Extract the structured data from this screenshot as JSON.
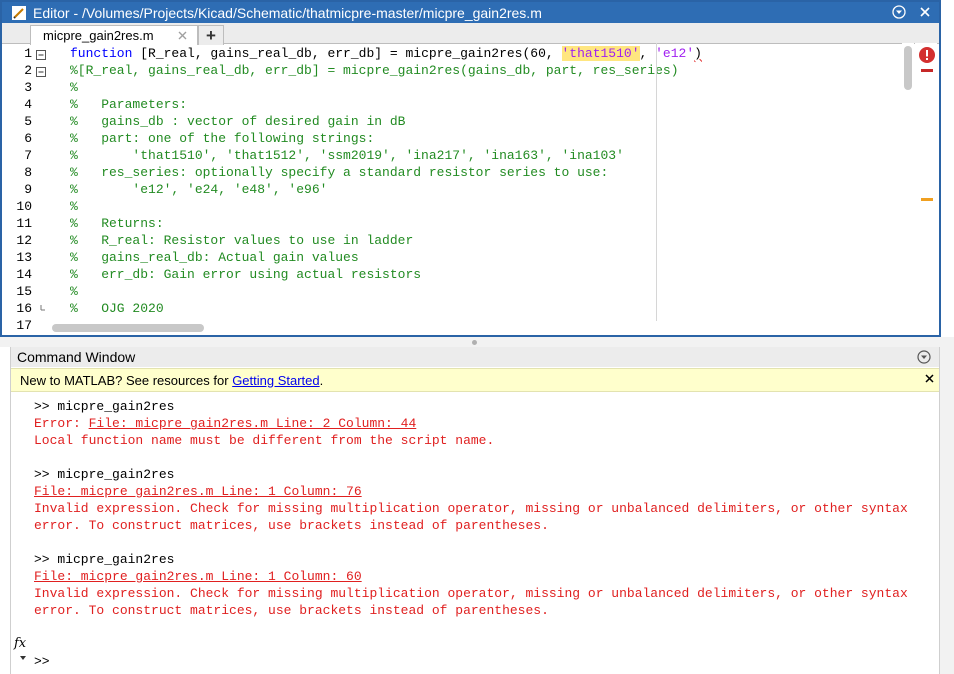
{
  "editor": {
    "title": "Editor - /Volumes/Projects/Kicad/Schematic/thatmicpre-master/micpre_gain2res.m",
    "tab_label": "micpre_gain2res.m",
    "add_tab": "+",
    "lines": [
      {
        "n": "1",
        "fold": "minus",
        "parts": [
          {
            "t": "function",
            "c": "kw"
          },
          {
            "t": " [R_real, gains_real_db, err_db] = micpre_gain2res(60, ",
            "c": ""
          },
          {
            "t": "'that1510'",
            "c": "str-hl"
          },
          {
            "t": ", ",
            "c": ""
          },
          {
            "t": "'e12'",
            "c": "str"
          },
          {
            "t": ")",
            "c": "squig"
          }
        ]
      },
      {
        "n": "2",
        "fold": "minus",
        "parts": [
          {
            "t": "%[R_real, gains_real_db, err_db] = micpre_gain2res(gains_db, part, res_series)",
            "c": "com"
          }
        ]
      },
      {
        "n": "3",
        "fold": "",
        "parts": [
          {
            "t": "%",
            "c": "com"
          }
        ]
      },
      {
        "n": "4",
        "fold": "",
        "parts": [
          {
            "t": "%   Parameters:",
            "c": "com"
          }
        ]
      },
      {
        "n": "5",
        "fold": "",
        "parts": [
          {
            "t": "%   gains_db : vector of desired gain in dB",
            "c": "com"
          }
        ]
      },
      {
        "n": "6",
        "fold": "",
        "parts": [
          {
            "t": "%   part: one of the following strings:",
            "c": "com"
          }
        ]
      },
      {
        "n": "7",
        "fold": "",
        "parts": [
          {
            "t": "%       'that1510', 'that1512', 'ssm2019', 'ina217', 'ina163', 'ina103'",
            "c": "com"
          }
        ]
      },
      {
        "n": "8",
        "fold": "",
        "parts": [
          {
            "t": "%   res_series: optionally specify a standard resistor series to use:",
            "c": "com"
          }
        ]
      },
      {
        "n": "9",
        "fold": "",
        "parts": [
          {
            "t": "%       'e12', 'e24, 'e48', 'e96'",
            "c": "com"
          }
        ]
      },
      {
        "n": "10",
        "fold": "",
        "parts": [
          {
            "t": "%",
            "c": "com"
          }
        ]
      },
      {
        "n": "11",
        "fold": "",
        "parts": [
          {
            "t": "%   Returns:",
            "c": "com"
          }
        ]
      },
      {
        "n": "12",
        "fold": "",
        "parts": [
          {
            "t": "%   R_real: Resistor values to use in ladder",
            "c": "com"
          }
        ]
      },
      {
        "n": "13",
        "fold": "",
        "parts": [
          {
            "t": "%   gains_real_db: Actual gain values",
            "c": "com"
          }
        ]
      },
      {
        "n": "14",
        "fold": "",
        "parts": [
          {
            "t": "%   err_db: Gain error using actual resistors",
            "c": "com"
          }
        ]
      },
      {
        "n": "15",
        "fold": "",
        "parts": [
          {
            "t": "%",
            "c": "com"
          }
        ]
      },
      {
        "n": "16",
        "fold": "end",
        "parts": [
          {
            "t": "%   OJG 2020",
            "c": "com"
          }
        ]
      },
      {
        "n": "17",
        "fold": "",
        "parts": [
          {
            "t": "",
            "c": ""
          }
        ]
      }
    ]
  },
  "command_window": {
    "title": "Command Window",
    "info": {
      "text": "New to MATLAB? See resources for ",
      "link": "Getting Started",
      "suffix": "."
    },
    "entries": [
      {
        "kind": "prompt",
        "text": ">> micpre_gain2res"
      },
      {
        "kind": "err-mixed",
        "prefix": "Error: ",
        "link": "File: micpre_gain2res.m Line: 2 Column: 44"
      },
      {
        "kind": "err",
        "text": "Local function name must be different from the script name."
      },
      {
        "kind": "blank",
        "text": ""
      },
      {
        "kind": "prompt",
        "text": ">> micpre_gain2res"
      },
      {
        "kind": "err-link",
        "text": "File: micpre_gain2res.m Line: 1 Column: 76"
      },
      {
        "kind": "err",
        "text": "Invalid expression. Check for missing multiplication operator, missing or unbalanced delimiters, or other syntax"
      },
      {
        "kind": "err",
        "text": "error. To construct matrices, use brackets instead of parentheses."
      },
      {
        "kind": "blank",
        "text": ""
      },
      {
        "kind": "prompt",
        "text": ">> micpre_gain2res"
      },
      {
        "kind": "err-link",
        "text": "File: micpre_gain2res.m Line: 1 Column: 60"
      },
      {
        "kind": "err",
        "text": "Invalid expression. Check for missing multiplication operator, missing or unbalanced delimiters, or other syntax"
      },
      {
        "kind": "err",
        "text": "error. To construct matrices, use brackets instead of parentheses."
      },
      {
        "kind": "blank",
        "text": ""
      },
      {
        "kind": "blank",
        "text": ""
      },
      {
        "kind": "prompt",
        "text": ">>"
      }
    ],
    "fx_label": "fx"
  },
  "colors": {
    "titlebar": "#2e6db4",
    "comment": "#228b22",
    "keyword": "#0000ff",
    "string": "#a020f0",
    "error": "#e02020",
    "info_bar": "#ffffcc"
  },
  "icons": {
    "title_app": "editor-app-icon",
    "title_menu": "chevron-down-circle-icon",
    "title_close": "close-icon",
    "tab_close": "close-icon",
    "analyzer": "error-indicator-icon",
    "cmd_menu": "chevron-down-circle-icon",
    "info_close": "close-icon",
    "fx": "function-browser-icon"
  }
}
